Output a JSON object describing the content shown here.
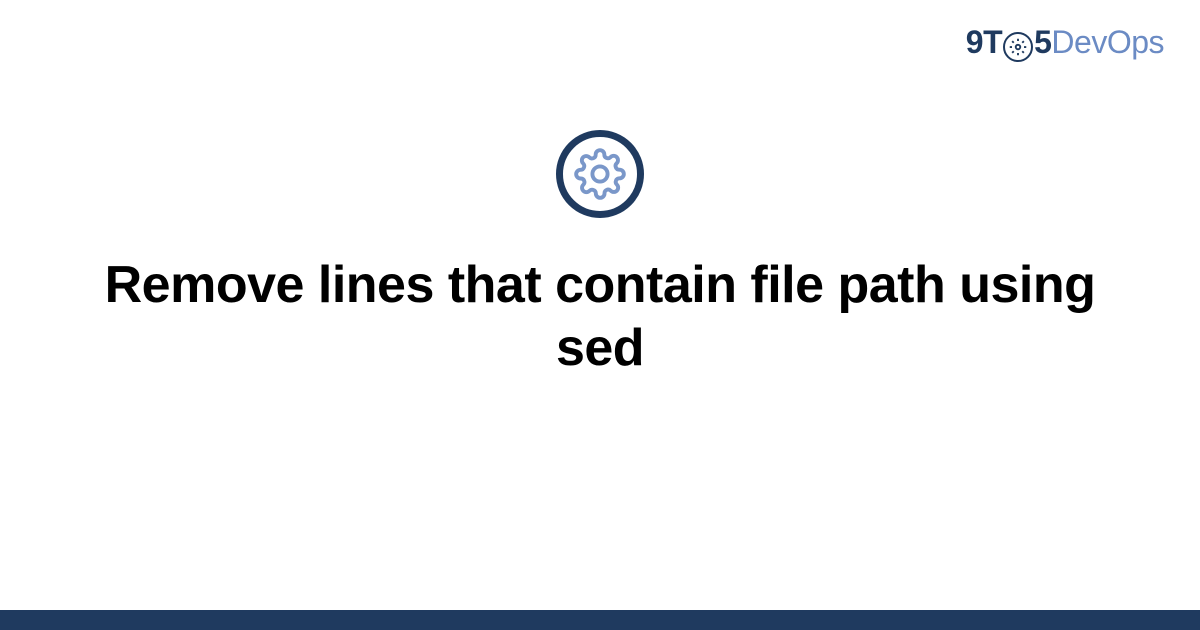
{
  "brand": {
    "part1": "9T",
    "part2": "5",
    "part3": "DevOps"
  },
  "title": "Remove lines that contain file path using sed",
  "colors": {
    "dark_navy": "#1f3a5f",
    "light_blue": "#6b8bc4",
    "icon_blue": "#7a97c9"
  }
}
